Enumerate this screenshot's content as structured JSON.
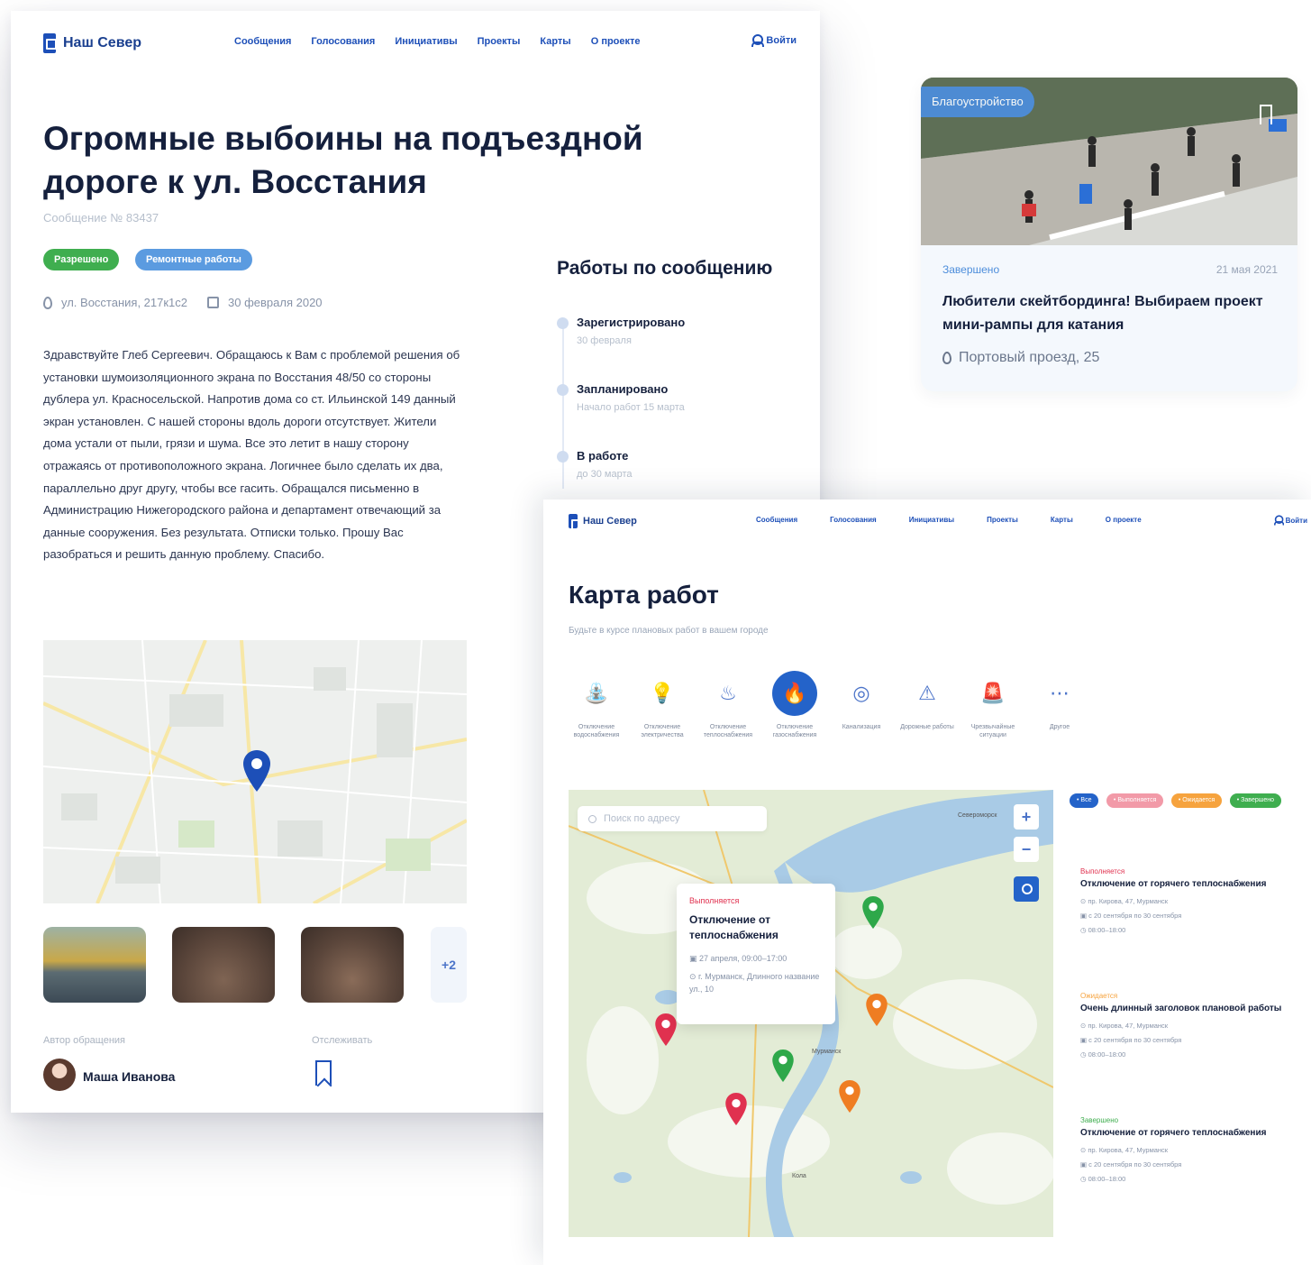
{
  "message_page": {
    "nav": {
      "logo": "Наш Север",
      "links": [
        "Сообщения",
        "Голосования",
        "Инициативы",
        "Проекты",
        "Карты",
        "О проекте"
      ],
      "login": "Войти"
    },
    "title": "Огромные выбоины на подъездной дороге к ул. Восстания",
    "number": "Сообщение № 83437",
    "tags": [
      {
        "label": "Разрешено",
        "color": "#3fae4f"
      },
      {
        "label": "Ремонтные работы",
        "color": "#5b9be0"
      }
    ],
    "address": "ул. Восстания, 217к1с2",
    "date": "30 февраля 2020",
    "body": "Здравствуйте Глеб Сергеевич. Обращаюсь к Вам с проблемой решения об установки шумоизоляционного экрана по Восстания 48/50 со стороны дублера ул. Красносельской. Напротив дома со ст. Ильинской 149 данный экран установлен. С нашей стороны вдоль дороги отсутствует. Жители дома устали от пыли, грязи и шума. Все это летит в нашу сторону отражаясь от противоположного экрана. Логичнее было сделать их два, параллельно друг другу, чтобы все гасить. Обращался письменно в Администрацию Нижегородского района и департамент отвечающий за данные сооружения. Без результата. Отписки только. Прошу Вас разобраться и решить данную проблему. Спасибо.",
    "more_photos": "+2",
    "author_label": "Автор обращения",
    "author_name": "Маша Иванова",
    "track_label": "Отслеживать",
    "works_title": "Работы по сообщению",
    "timeline": [
      {
        "title": "Зарегистрировано",
        "sub": "30 февраля"
      },
      {
        "title": "Запланировано",
        "sub": "Начало работ 15 марта"
      },
      {
        "title": "В работе",
        "sub": "до 30 марта"
      }
    ]
  },
  "project_card": {
    "badge": "Благоустройство",
    "status": "Завершено",
    "date": "21 мая 2021",
    "title": "Любители скейтбординга! Выбираем проект мини-рампы для катания",
    "address": "Портовый проезд, 25"
  },
  "map_page": {
    "nav": {
      "logo": "Наш Север",
      "links": [
        "Сообщения",
        "Голосования",
        "Инициативы",
        "Проекты",
        "Карты",
        "О проекте"
      ],
      "login": "Войти"
    },
    "title": "Карта работ",
    "subtitle": "Будьте в курсе плановых работ в вашем городе",
    "categories": [
      {
        "label": "Отключение водоснабжения",
        "icon": "faucet-icon",
        "glyph": "⛲",
        "active": false
      },
      {
        "label": "Отключение электричества",
        "icon": "lightbulb-icon",
        "glyph": "💡",
        "active": false
      },
      {
        "label": "Отключение теплоснабжения",
        "icon": "heating-icon",
        "glyph": "♨",
        "active": false
      },
      {
        "label": "Отключение газоснабжения",
        "icon": "gas-icon",
        "glyph": "🔥",
        "active": true
      },
      {
        "label": "Канализация",
        "icon": "sewer-icon",
        "glyph": "◎",
        "active": false
      },
      {
        "label": "Дорожные работы",
        "icon": "roadworks-icon",
        "glyph": "⚠",
        "active": false
      },
      {
        "label": "Чрезвычайные ситуации",
        "icon": "emergency-icon",
        "glyph": "🚨",
        "active": false
      },
      {
        "label": "Другое",
        "icon": "other-icon",
        "glyph": "⋯",
        "active": false
      }
    ],
    "search_placeholder": "Поиск по адресу",
    "map_labels": [
      "Североморск",
      "Мурманск",
      "Кола"
    ],
    "popup": {
      "status": "Выполняется",
      "title": "Отключение от теплоснабжения",
      "date": "27 апреля, 09:00–17:00",
      "address": "г. Мурманск, Длинного название ул., 10"
    },
    "filters": [
      {
        "label": "• Все",
        "color": "#2463c9"
      },
      {
        "label": "• Выполняется",
        "color": "#f29aa8"
      },
      {
        "label": "• Ожидается",
        "color": "#f6a33e"
      },
      {
        "label": "• Завершено",
        "color": "#3fae4f"
      }
    ],
    "list": [
      {
        "status": "Выполняется",
        "status_color": "#e0314f",
        "title": "Отключение от горячего теплоснабжения",
        "address": "пр. Кирова, 47, Мурманск",
        "dates": "с 20 сентября по 30 сентября",
        "time": "08:00–18:00"
      },
      {
        "status": "Ожидается",
        "status_color": "#f6a33e",
        "title": "Очень длинный заголовок плановой работы",
        "address": "пр. Кирова, 47, Мурманск",
        "dates": "с 20 сентября по 30 сентября",
        "time": "08:00–18:00"
      },
      {
        "status": "Завершено",
        "status_color": "#3fae4f",
        "title": "Отключение от горячего теплоснабжения",
        "address": "пр. Кирова, 47, Мурманск",
        "dates": "с 20 сентября по 30 сентября",
        "time": "08:00–18:00"
      }
    ]
  }
}
